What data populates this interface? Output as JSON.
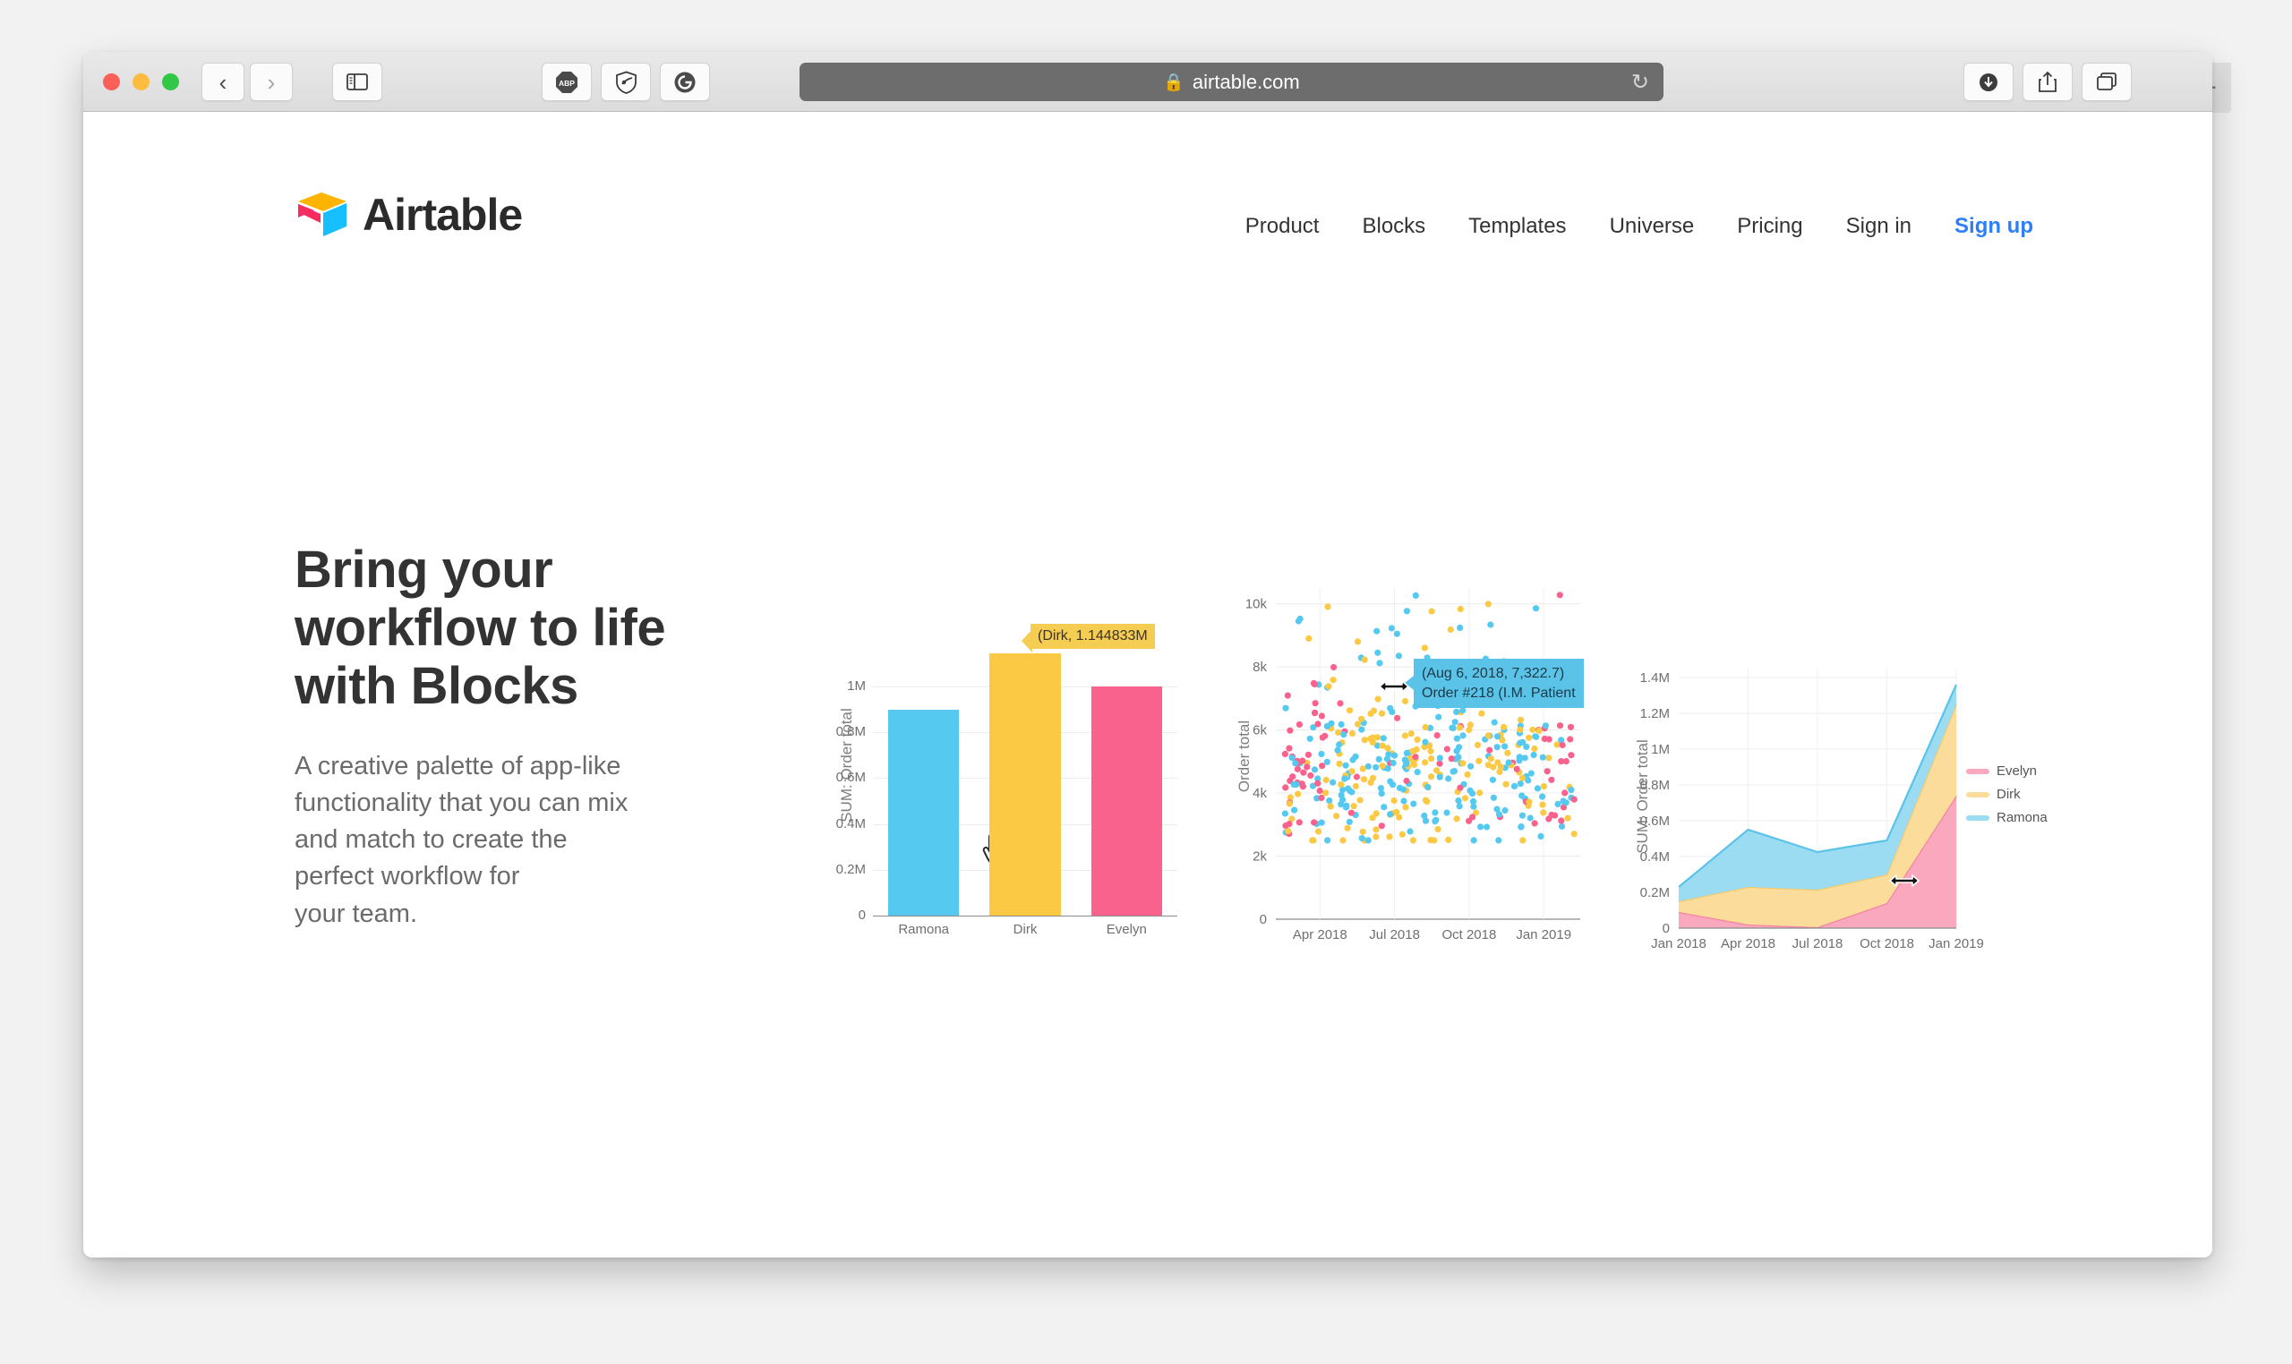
{
  "browser": {
    "url": "airtable.com",
    "lock_icon": "lock-icon",
    "back_icon": "chevron-left-icon",
    "forward_icon": "chevron-right-icon",
    "sidebar_icon": "sidebar-icon",
    "reload_icon": "reload-icon",
    "newtab_label": "+",
    "extensions": [
      {
        "name": "abp-extension-icon",
        "label": "ABP"
      },
      {
        "name": "shield-extension-icon",
        "label": ""
      },
      {
        "name": "grammarly-extension-icon",
        "label": "G"
      }
    ],
    "right_buttons": [
      {
        "name": "downloads-icon",
        "label": ""
      },
      {
        "name": "share-icon",
        "label": ""
      },
      {
        "name": "tab-overview-icon",
        "label": ""
      }
    ]
  },
  "site": {
    "brand": "Airtable",
    "nav": [
      {
        "label": "Product",
        "accent": false
      },
      {
        "label": "Blocks",
        "accent": false
      },
      {
        "label": "Templates",
        "accent": false
      },
      {
        "label": "Universe",
        "accent": false
      },
      {
        "label": "Pricing",
        "accent": false
      },
      {
        "label": "Sign in",
        "accent": false
      },
      {
        "label": "Sign up",
        "accent": true
      }
    ],
    "accent_color": "#2d7ff9"
  },
  "hero": {
    "title_line1": "Bring your",
    "title_line2": "workflow to life",
    "title_line3": "with Blocks",
    "paragraph_line1": "A creative palette of app-like",
    "paragraph_line2": "functionality that you can mix",
    "paragraph_line3": "and match to create the",
    "paragraph_line4": "perfect workflow for",
    "paragraph_line5": "your team."
  },
  "colors": {
    "blue": "#55c9ef",
    "yellow": "#fbc944",
    "pink": "#f9628c",
    "area_pink": "#f9a8bd",
    "area_yellow": "#fbdc9a",
    "area_blue": "#9bdcf3",
    "tooltip_yellow": "#f5cd52",
    "tooltip_blue": "#5cc3e8"
  },
  "chart_data": [
    {
      "id": "bar-chart",
      "type": "bar",
      "title": "",
      "xlabel": "",
      "ylabel": "SUM: Order total",
      "categories": [
        "Ramona",
        "Dirk",
        "Evelyn"
      ],
      "values": [
        0.9,
        1.144833,
        1.0
      ],
      "colors": [
        "#55c9ef",
        "#fbc944",
        "#f9628c"
      ],
      "ytick_labels": [
        "0",
        "0.2M",
        "0.4M",
        "0.6M",
        "0.8M",
        "1M"
      ],
      "ytick_values": [
        0,
        0.2,
        0.4,
        0.6,
        0.8,
        1.0
      ],
      "ylim": [
        0,
        1.25
      ],
      "grid": true,
      "tooltip": "(Dirk, 1.144833M",
      "tooltip_target": "Dirk",
      "cursor": "pointer-hand-cursor"
    },
    {
      "id": "scatter-chart",
      "type": "scatter",
      "title": "",
      "xlabel": "",
      "ylabel": "Order total",
      "ytick_labels": [
        "0",
        "2k",
        "4k",
        "6k",
        "8k",
        "10k"
      ],
      "ytick_values": [
        0,
        2000,
        4000,
        6000,
        8000,
        10000
      ],
      "ylim": [
        0,
        10500
      ],
      "xtick_labels": [
        "Apr 2018",
        "Jul 2018",
        "Oct 2018",
        "Jan 2019"
      ],
      "grid": true,
      "legend_position": "none",
      "series": [
        {
          "name": "Ramona",
          "color": "#55c9ef"
        },
        {
          "name": "Dirk",
          "color": "#fbc944"
        },
        {
          "name": "Evelyn",
          "color": "#f9628c"
        }
      ],
      "tooltip_line1": "(Aug 6, 2018, 7,322.7)",
      "tooltip_line2": "Order #218 (I.M. Patient",
      "cursor": "horizontal-resize-cursor"
    },
    {
      "id": "area-chart",
      "type": "area",
      "stacked": true,
      "title": "",
      "xlabel": "",
      "ylabel": "SUM: Order total",
      "categories": [
        "Jan 2018",
        "Apr 2018",
        "Jul 2018",
        "Oct 2018",
        "Jan 2019"
      ],
      "ytick_labels": [
        "0",
        "0.2M",
        "0.4M",
        "0.6M",
        "0.8M",
        "1M",
        "1.2M",
        "1.4M"
      ],
      "ytick_values": [
        0,
        0.2,
        0.4,
        0.6,
        0.8,
        1.0,
        1.2,
        1.4
      ],
      "ylim": [
        0,
        1.45
      ],
      "grid": true,
      "legend_position": "right",
      "series": [
        {
          "name": "Evelyn",
          "color": "#f9a8bd",
          "values": [
            0.09,
            0.02,
            0.005,
            0.14,
            0.74
          ]
        },
        {
          "name": "Dirk",
          "color": "#fbdc9a",
          "values": [
            0.06,
            0.21,
            0.21,
            0.16,
            0.51
          ]
        },
        {
          "name": "Ramona",
          "color": "#9bdcf3",
          "values": [
            0.08,
            0.32,
            0.21,
            0.19,
            0.11
          ]
        }
      ],
      "legend_entries": [
        {
          "label": "Evelyn",
          "color": "#f9a8bd"
        },
        {
          "label": "Dirk",
          "color": "#fbdc9a"
        },
        {
          "label": "Ramona",
          "color": "#9bdcf3"
        }
      ],
      "cursor": "horizontal-resize-cursor"
    }
  ]
}
